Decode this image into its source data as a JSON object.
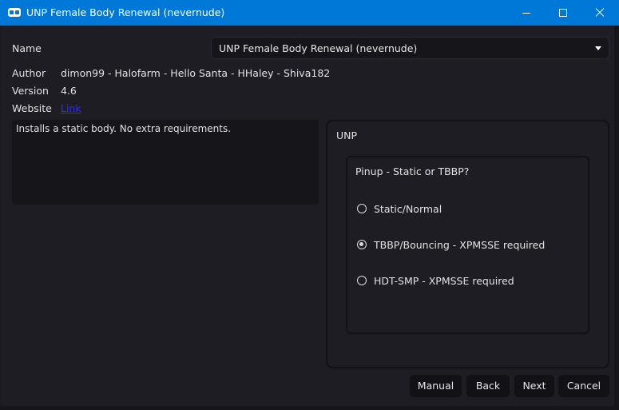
{
  "window": {
    "title": "UNP Female Body Renewal (nevernude)"
  },
  "form": {
    "name_label": "Name",
    "name_value": "UNP Female Body Renewal (nevernude)",
    "author_label": "Author",
    "author_value": "dimon99 - Halofarm - Hello Santa - HHaley - Shiva182",
    "version_label": "Version",
    "version_value": "4.6",
    "website_label": "Website",
    "website_link": "Link"
  },
  "description": "Installs a static body. No extra requirements.",
  "group": {
    "title": "UNP",
    "question": "Pinup - Static or TBBP?",
    "options": [
      {
        "label": "Static/Normal",
        "selected": false
      },
      {
        "label": "TBBP/Bouncing - XPMSSE required",
        "selected": true
      },
      {
        "label": "HDT-SMP - XPMSSE required",
        "selected": false
      }
    ]
  },
  "buttons": {
    "manual": "Manual",
    "back": "Back",
    "next": "Next",
    "cancel": "Cancel"
  },
  "colors": {
    "titlebar": "#0078d7",
    "background": "#1f1d24",
    "field": "#16151a",
    "link": "#2b2bff"
  }
}
